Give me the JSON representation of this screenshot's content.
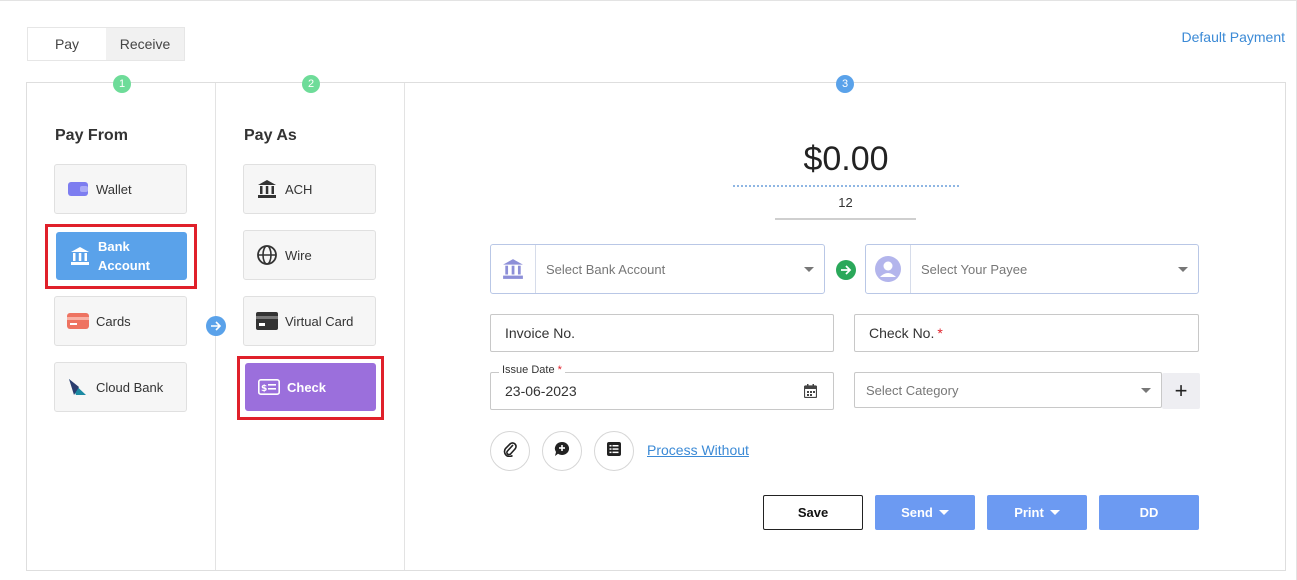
{
  "tabs": [
    {
      "label": "Pay",
      "active": true
    },
    {
      "label": "Receive",
      "active": false
    }
  ],
  "default_payment_link": "Default Payment",
  "steps": [
    "1",
    "2",
    "3"
  ],
  "pay_from": {
    "title": "Pay From",
    "options": [
      {
        "label": "Wallet",
        "icon": "wallet-icon"
      },
      {
        "label": "Bank Account",
        "icon": "bank-icon",
        "selected": true
      },
      {
        "label": "Cards",
        "icon": "card-icon"
      },
      {
        "label": "Cloud Bank",
        "icon": "cloud-bank-icon"
      }
    ]
  },
  "pay_as": {
    "title": "Pay As",
    "options": [
      {
        "label": "ACH",
        "icon": "bank-icon"
      },
      {
        "label": "Wire",
        "icon": "globe-icon"
      },
      {
        "label": "Virtual Card",
        "icon": "virtual-card-icon"
      },
      {
        "label": "Check",
        "icon": "check-icon",
        "selected": true
      }
    ]
  },
  "payment": {
    "amount": "$0.00",
    "sub_value": "12",
    "bank_select_placeholder": "Select Bank Account",
    "payee_select_placeholder": "Select Your Payee",
    "invoice_placeholder": "Invoice No.",
    "check_placeholder": "Check No.",
    "required_mark": "*",
    "issue_date_label": "Issue Date",
    "issue_date_value": "23-06-2023",
    "category_placeholder": "Select Category",
    "add_symbol": "+",
    "process_without_link": "Process Without"
  },
  "actions": {
    "save": "Save",
    "send": "Send",
    "print": "Print",
    "dd": "DD"
  },
  "colors": {
    "accent_blue": "#5aa2ea",
    "accent_purple": "#9b6fdc",
    "button_blue": "#6c9af2",
    "step_green": "#6edc99",
    "highlight_red": "#e0202a"
  }
}
